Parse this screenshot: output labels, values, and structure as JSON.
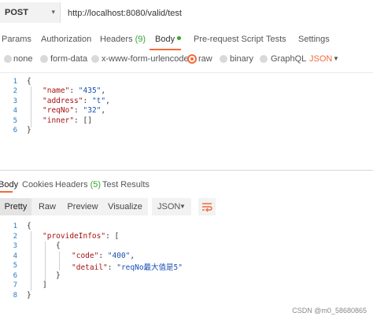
{
  "request": {
    "method": "POST",
    "url": "http://localhost:8080/valid/test"
  },
  "tabs": [
    {
      "label": "Params"
    },
    {
      "label": "Authorization"
    },
    {
      "label": "Headers",
      "count": "(9)"
    },
    {
      "label": "Body",
      "active": true
    },
    {
      "label": "Pre-request Script"
    },
    {
      "label": "Tests"
    },
    {
      "label": "Settings"
    }
  ],
  "body_types": [
    "none",
    "form-data",
    "x-www-form-urlencoded",
    "raw",
    "binary",
    "GraphQL"
  ],
  "body_type_selected": "raw",
  "raw_format": "JSON",
  "request_body_lines": [
    "1",
    "2",
    "3",
    "4",
    "5",
    "6"
  ],
  "request_body": {
    "open": "{",
    "l2_key": "\"name\"",
    "l2_val": "\"435\"",
    "l3_key": "\"address\"",
    "l3_val": "\"t\"",
    "l4_key": "\"reqNo\"",
    "l4_val": "\"32\"",
    "l5_key": "\"inner\"",
    "l5_val": "[]",
    "close": "}"
  },
  "response_tabs": [
    {
      "label": "Body",
      "active": true
    },
    {
      "label": "Cookies"
    },
    {
      "label": "Headers",
      "count": "(5)"
    },
    {
      "label": "Test Results"
    }
  ],
  "view_modes": [
    "Pretty",
    "Raw",
    "Preview",
    "Visualize"
  ],
  "response_format": "JSON",
  "response_body_lines": [
    "1",
    "2",
    "3",
    "4",
    "5",
    "6",
    "7",
    "8"
  ],
  "response_body": {
    "l1": "{",
    "l2_key": "\"provideInfos\"",
    "l2_rest": "[",
    "l3": "{",
    "l4_key": "\"code\"",
    "l4_val": "\"400\"",
    "l5_key": "\"detail\"",
    "l5_val": "\"reqNo最大值是5\"",
    "l6": "}",
    "l7": "]",
    "l8": "}"
  },
  "watermark": "CSDN @m0_58680865",
  "colors": {
    "accent": "#f26b3a",
    "count_green": "#35a62c",
    "line_number_blue": "#2a7bbf"
  }
}
